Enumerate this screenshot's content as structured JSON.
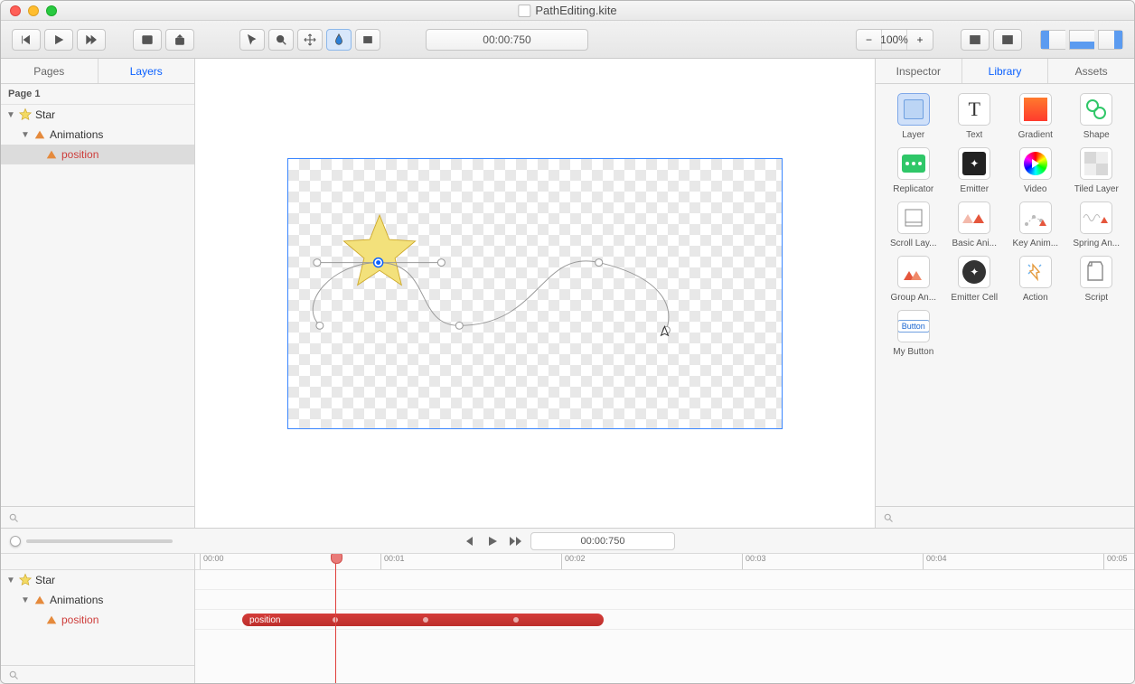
{
  "window": {
    "title": "PathEditing.kite"
  },
  "toolbar": {
    "zoom": "100%",
    "time": "00:00:750"
  },
  "left": {
    "tabs": {
      "pages": "Pages",
      "layers": "Layers"
    },
    "page": "Page 1",
    "tree": {
      "root": "Star",
      "group": "Animations",
      "prop": "position"
    }
  },
  "right": {
    "tabs": {
      "inspector": "Inspector",
      "library": "Library",
      "assets": "Assets"
    },
    "items": {
      "layer": "Layer",
      "text": "Text",
      "gradient": "Gradient",
      "shape": "Shape",
      "replicator": "Replicator",
      "emitter": "Emitter",
      "video": "Video",
      "tiled": "Tiled Layer",
      "scroll": "Scroll Lay...",
      "basic": "Basic Ani...",
      "key": "Key Anim...",
      "spring": "Spring An...",
      "group": "Group An...",
      "emittercell": "Emitter Cell",
      "action": "Action",
      "script": "Script",
      "mybutton": "My Button",
      "button_inner": "Button"
    }
  },
  "timeline": {
    "time": "00:00:750",
    "ruler": [
      "00:00",
      "00:01",
      "00:02",
      "00:03",
      "00:04",
      "00:05"
    ],
    "tree": {
      "root": "Star",
      "group": "Animations",
      "prop": "position"
    },
    "bar_label": "position"
  }
}
